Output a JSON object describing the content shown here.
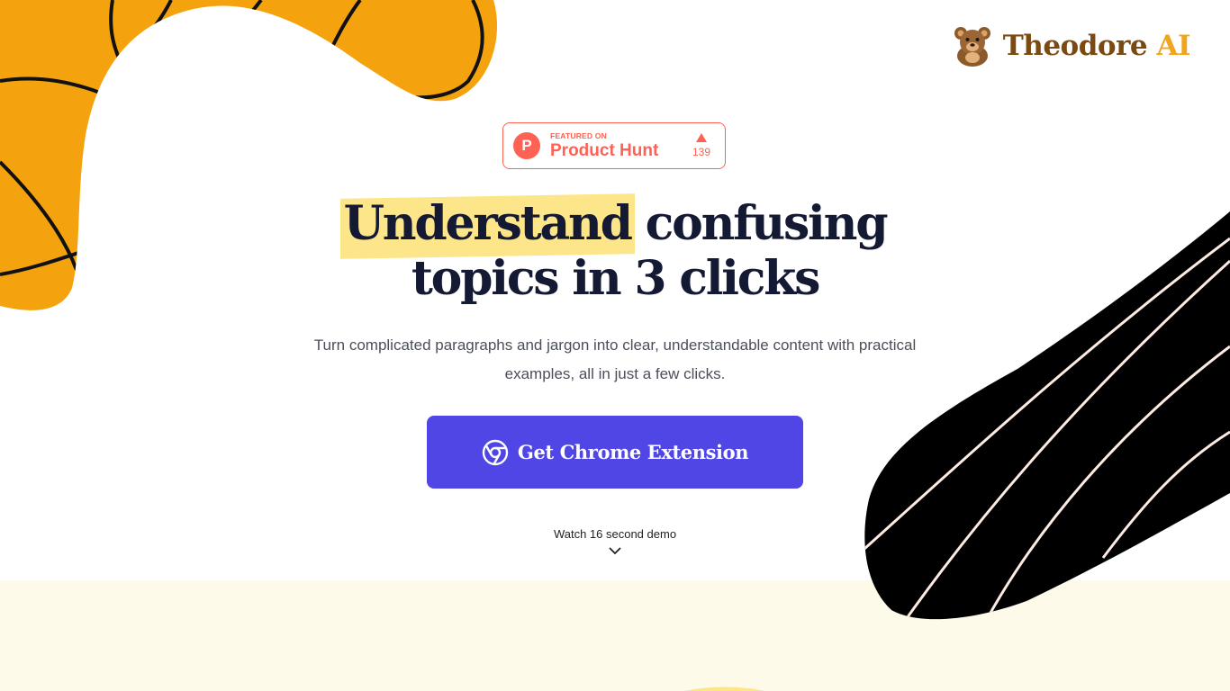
{
  "brand": {
    "name": "Theodore",
    "name_suffix": "AI",
    "logo_icon": "teddy-bear-icon"
  },
  "product_hunt": {
    "featured_on": "FEATURED ON",
    "name": "Product Hunt",
    "logo_letter": "P",
    "upvote_count": "139"
  },
  "hero": {
    "headline_highlight": "Understand",
    "headline_rest_line1": " confusing",
    "headline_line2": "topics in 3 clicks",
    "subtitle": "Turn complicated paragraphs and jargon into clear, understandable content with practical examples, all in just a few clicks.",
    "cta_label": "Get Chrome Extension",
    "cta_icon": "chrome-icon",
    "demo_label": "Watch 16 second demo",
    "demo_icon": "chevron-down-icon"
  },
  "colors": {
    "accent_purple": "#4f46e5",
    "highlight_yellow": "#fde68a",
    "orange_blob": "#f5a20f",
    "product_hunt": "#ff6154",
    "brand_brown": "#7a4a12",
    "brand_ai": "#f0a51d",
    "bottom_band": "#fefaea"
  }
}
